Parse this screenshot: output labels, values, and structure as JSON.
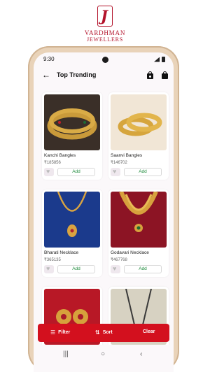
{
  "brand": {
    "mark": "J",
    "name": "VARDHMAN",
    "sub": "JEWELLERS",
    "color": "#b3122a"
  },
  "status": {
    "time": "9:30"
  },
  "header": {
    "back_icon": "arrow-left-icon",
    "title": "Top Trending",
    "icons": [
      "shopping-bag-icon",
      "shopping-bag-icon"
    ]
  },
  "products": [
    {
      "name": "Kanchi Bangles",
      "price": "₹185856",
      "add": "Add"
    },
    {
      "name": "Saanvi Bangles",
      "price": "₹146702",
      "add": "Add"
    },
    {
      "name": "Bharati Necklace",
      "price": "₹365135",
      "add": "Add"
    },
    {
      "name": "Godavari Necklace",
      "price": "₹467768",
      "add": "Add"
    },
    {
      "name": "",
      "price": "",
      "add": ""
    },
    {
      "name": "",
      "price": "",
      "add": ""
    }
  ],
  "bottom_bar": {
    "filter": "Filter",
    "sort": "Sort",
    "clear": "Clear",
    "color": "#d3101e"
  },
  "nav": {
    "recents": "|||",
    "home": "○",
    "back": "‹"
  }
}
